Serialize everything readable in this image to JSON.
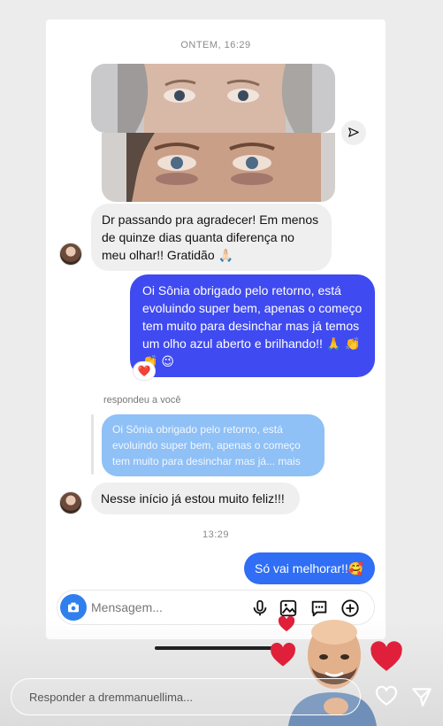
{
  "chat": {
    "timestamp_1": "ONTEM, 16:29",
    "msg_1": "Dr passando pra agradecer! Em menos de quinze dias quanta diferença  no meu olhar!! Gratidão 🙏🏻",
    "msg_2": "Oi Sônia obrigado pelo retorno, está evoluindo super bem, apenas o começo tem muito para desinchar mas já temos um olho azul aberto e brilhando!! 🙏 👏 👏 😉",
    "reaction": "❤️",
    "replied_label": "respondeu a você",
    "quoted": "Oi Sônia obrigado pelo retorno, está evoluindo super bem, apenas o começo tem muito para desinchar mas já... mais",
    "msg_3": "Nesse início já  estou muito feliz!!!",
    "timestamp_2": "13:29",
    "msg_4": "Só vai melhorar!!🥰"
  },
  "composer": {
    "placeholder": "Mensagem..."
  },
  "story_reply": {
    "placeholder": "Responder a dremmanuellima..."
  },
  "icons": {
    "camera": "camera-icon",
    "mic": "microphone-icon",
    "gallery": "gallery-icon",
    "sticker": "chat-sticker-icon",
    "plus": "plus-icon",
    "share": "share-icon",
    "heart": "heart-icon",
    "send": "send-icon"
  },
  "colors": {
    "outgoing": "#3f4af0",
    "outgoing_latest": "#2f6ef5",
    "incoming": "#efefef",
    "accent": "#2f80ed",
    "heart": "#e0245e"
  }
}
